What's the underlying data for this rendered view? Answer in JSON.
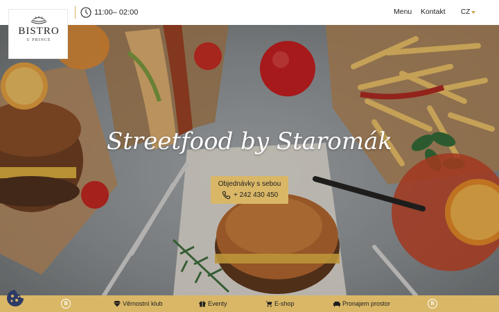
{
  "header": {
    "hours": "11:00– 02:00",
    "clock_icon": "clock-icon",
    "nav": [
      {
        "label": "Menu"
      },
      {
        "label": "Kontakt"
      }
    ],
    "language": "CZ"
  },
  "logo": {
    "title": "BISTRO",
    "subtitle": "U PRINCE"
  },
  "hero": {
    "title": "Streetfood by Staromák",
    "order": {
      "label": "Objednávky s sebou",
      "phone": "+ 242 430 450"
    }
  },
  "footer_bar": {
    "badge_letter": "B",
    "items": [
      {
        "label": "Věrnostní klub",
        "icon": "diamond-icon"
      },
      {
        "label": "Eventy",
        "icon": "gift-icon"
      },
      {
        "label": "E-shop",
        "icon": "cart-icon"
      },
      {
        "label": "Pronajem prostor",
        "icon": "sofa-icon"
      }
    ]
  },
  "colors": {
    "accent": "#d9b767",
    "divider": "#d6b35c",
    "cookie": "#2d3a66"
  }
}
